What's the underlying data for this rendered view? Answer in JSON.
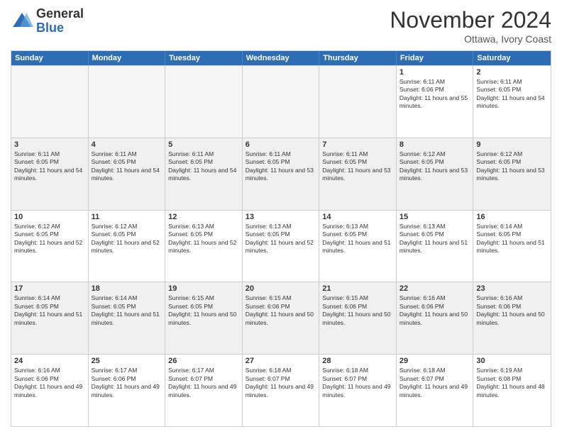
{
  "logo": {
    "general": "General",
    "blue": "Blue"
  },
  "title": "November 2024",
  "subtitle": "Ottawa, Ivory Coast",
  "days": [
    "Sunday",
    "Monday",
    "Tuesday",
    "Wednesday",
    "Thursday",
    "Friday",
    "Saturday"
  ],
  "rows": [
    [
      {
        "day": "",
        "empty": true
      },
      {
        "day": "",
        "empty": true
      },
      {
        "day": "",
        "empty": true
      },
      {
        "day": "",
        "empty": true
      },
      {
        "day": "",
        "empty": true
      },
      {
        "day": "1",
        "sunrise": "6:11 AM",
        "sunset": "6:06 PM",
        "daylight": "11 hours and 55 minutes."
      },
      {
        "day": "2",
        "sunrise": "6:11 AM",
        "sunset": "6:05 PM",
        "daylight": "11 hours and 54 minutes."
      }
    ],
    [
      {
        "day": "3",
        "sunrise": "6:11 AM",
        "sunset": "6:05 PM",
        "daylight": "11 hours and 54 minutes."
      },
      {
        "day": "4",
        "sunrise": "6:11 AM",
        "sunset": "6:05 PM",
        "daylight": "11 hours and 54 minutes."
      },
      {
        "day": "5",
        "sunrise": "6:11 AM",
        "sunset": "6:05 PM",
        "daylight": "11 hours and 54 minutes."
      },
      {
        "day": "6",
        "sunrise": "6:11 AM",
        "sunset": "6:05 PM",
        "daylight": "11 hours and 53 minutes."
      },
      {
        "day": "7",
        "sunrise": "6:11 AM",
        "sunset": "6:05 PM",
        "daylight": "11 hours and 53 minutes."
      },
      {
        "day": "8",
        "sunrise": "6:12 AM",
        "sunset": "6:05 PM",
        "daylight": "11 hours and 53 minutes."
      },
      {
        "day": "9",
        "sunrise": "6:12 AM",
        "sunset": "6:05 PM",
        "daylight": "11 hours and 53 minutes."
      }
    ],
    [
      {
        "day": "10",
        "sunrise": "6:12 AM",
        "sunset": "6:05 PM",
        "daylight": "11 hours and 52 minutes."
      },
      {
        "day": "11",
        "sunrise": "6:12 AM",
        "sunset": "6:05 PM",
        "daylight": "11 hours and 52 minutes."
      },
      {
        "day": "12",
        "sunrise": "6:13 AM",
        "sunset": "6:05 PM",
        "daylight": "11 hours and 52 minutes."
      },
      {
        "day": "13",
        "sunrise": "6:13 AM",
        "sunset": "6:05 PM",
        "daylight": "11 hours and 52 minutes."
      },
      {
        "day": "14",
        "sunrise": "6:13 AM",
        "sunset": "6:05 PM",
        "daylight": "11 hours and 51 minutes."
      },
      {
        "day": "15",
        "sunrise": "6:13 AM",
        "sunset": "6:05 PM",
        "daylight": "11 hours and 51 minutes."
      },
      {
        "day": "16",
        "sunrise": "6:14 AM",
        "sunset": "6:05 PM",
        "daylight": "11 hours and 51 minutes."
      }
    ],
    [
      {
        "day": "17",
        "sunrise": "6:14 AM",
        "sunset": "6:05 PM",
        "daylight": "11 hours and 51 minutes."
      },
      {
        "day": "18",
        "sunrise": "6:14 AM",
        "sunset": "6:05 PM",
        "daylight": "11 hours and 51 minutes."
      },
      {
        "day": "19",
        "sunrise": "6:15 AM",
        "sunset": "6:05 PM",
        "daylight": "11 hours and 50 minutes."
      },
      {
        "day": "20",
        "sunrise": "6:15 AM",
        "sunset": "6:06 PM",
        "daylight": "11 hours and 50 minutes."
      },
      {
        "day": "21",
        "sunrise": "6:15 AM",
        "sunset": "6:06 PM",
        "daylight": "11 hours and 50 minutes."
      },
      {
        "day": "22",
        "sunrise": "6:16 AM",
        "sunset": "6:06 PM",
        "daylight": "11 hours and 50 minutes."
      },
      {
        "day": "23",
        "sunrise": "6:16 AM",
        "sunset": "6:06 PM",
        "daylight": "11 hours and 50 minutes."
      }
    ],
    [
      {
        "day": "24",
        "sunrise": "6:16 AM",
        "sunset": "6:06 PM",
        "daylight": "11 hours and 49 minutes."
      },
      {
        "day": "25",
        "sunrise": "6:17 AM",
        "sunset": "6:06 PM",
        "daylight": "11 hours and 49 minutes."
      },
      {
        "day": "26",
        "sunrise": "6:17 AM",
        "sunset": "6:07 PM",
        "daylight": "11 hours and 49 minutes."
      },
      {
        "day": "27",
        "sunrise": "6:18 AM",
        "sunset": "6:07 PM",
        "daylight": "11 hours and 49 minutes."
      },
      {
        "day": "28",
        "sunrise": "6:18 AM",
        "sunset": "6:07 PM",
        "daylight": "11 hours and 49 minutes."
      },
      {
        "day": "29",
        "sunrise": "6:18 AM",
        "sunset": "6:07 PM",
        "daylight": "11 hours and 49 minutes."
      },
      {
        "day": "30",
        "sunrise": "6:19 AM",
        "sunset": "6:08 PM",
        "daylight": "11 hours and 48 minutes."
      }
    ]
  ]
}
